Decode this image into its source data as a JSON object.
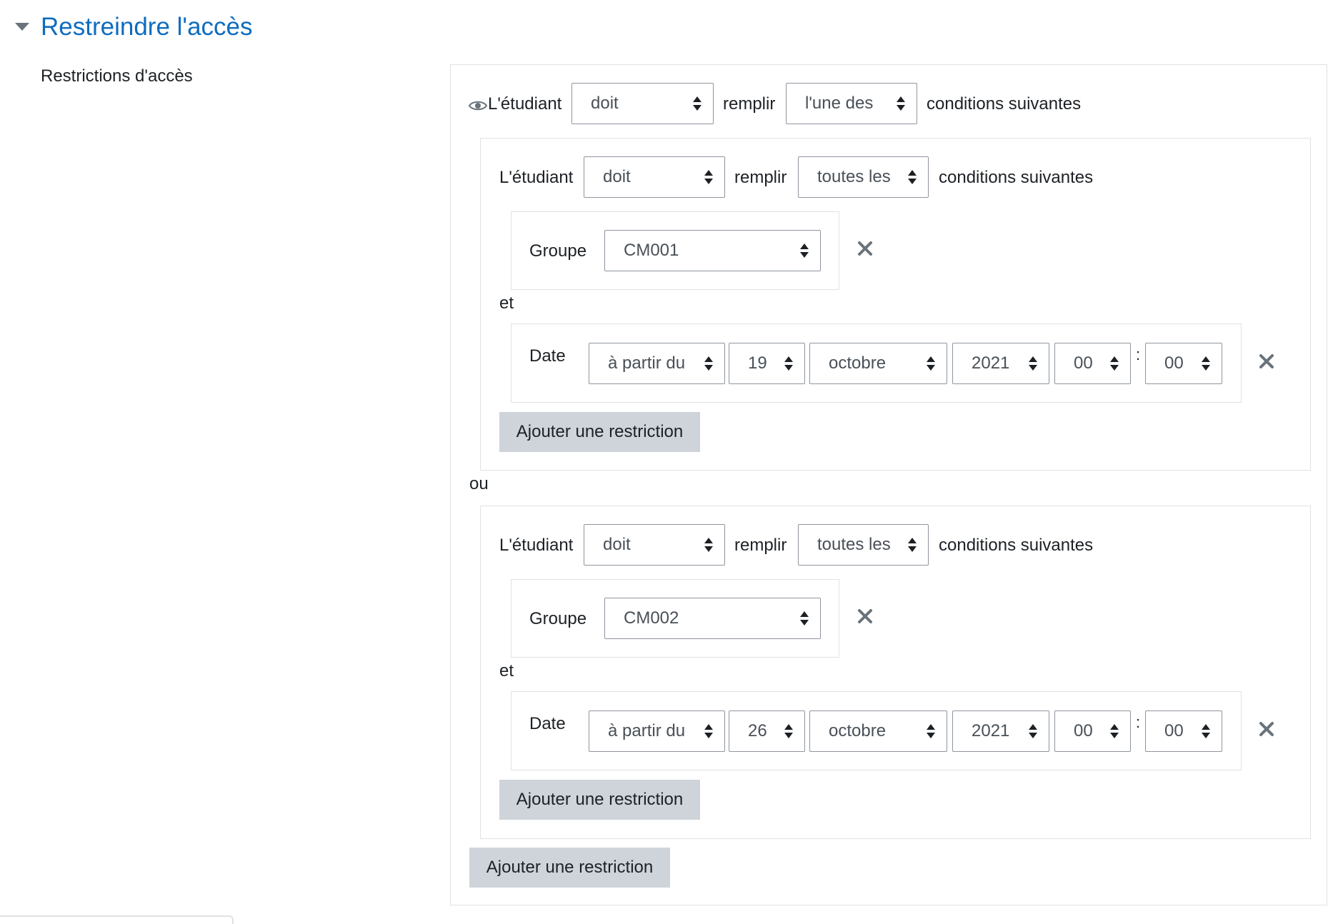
{
  "header": {
    "title": "Restreindre l'accès",
    "toggle_icon": "caret-down-icon"
  },
  "field_label": "Restrictions d'accès",
  "root": {
    "eye_icon": "eye-icon",
    "student_label": "L'étudiant",
    "must_value": "doit",
    "fill_label": "remplir",
    "match_value": "l'une des",
    "conditions_label": "conditions suivantes",
    "separator": "ou",
    "add_button": "Ajouter une restriction"
  },
  "sets": [
    {
      "student_label": "L'étudiant",
      "must_value": "doit",
      "fill_label": "remplir",
      "match_value": "toutes les",
      "conditions_label": "conditions suivantes",
      "group": {
        "label": "Groupe",
        "value": "CM001"
      },
      "and_label": "et",
      "date": {
        "label": "Date",
        "direction": "à partir du",
        "day": "19",
        "month": "octobre",
        "year": "2021",
        "hour": "00",
        "separator": ":",
        "minute": "00"
      },
      "add_button": "Ajouter une restriction"
    },
    {
      "student_label": "L'étudiant",
      "must_value": "doit",
      "fill_label": "remplir",
      "match_value": "toutes les",
      "conditions_label": "conditions suivantes",
      "group": {
        "label": "Groupe",
        "value": "CM002"
      },
      "and_label": "et",
      "date": {
        "label": "Date",
        "direction": "à partir du",
        "day": "26",
        "month": "octobre",
        "year": "2021",
        "hour": "00",
        "separator": ":",
        "minute": "00"
      },
      "add_button": "Ajouter une restriction"
    }
  ],
  "colors": {
    "link": "#0f6cbf",
    "button_bg": "#ced4da",
    "border": "#dee2e6",
    "select_border": "#8f959e"
  }
}
